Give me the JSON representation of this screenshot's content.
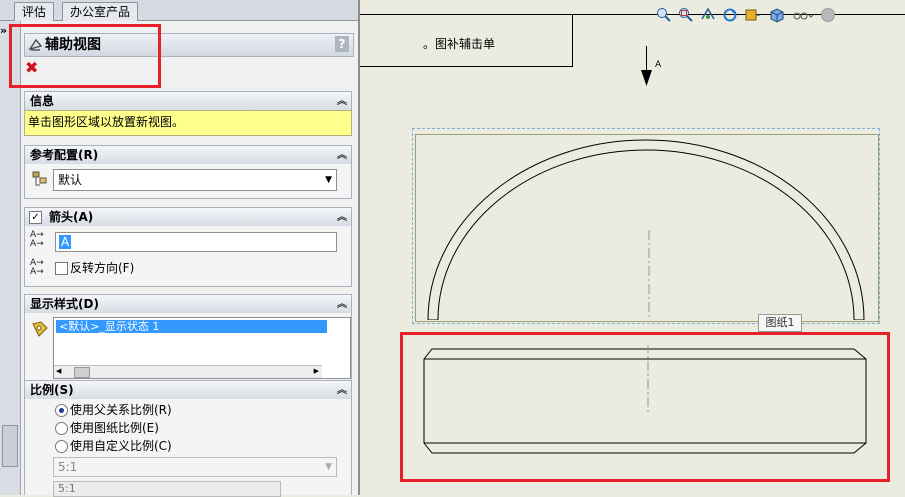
{
  "tabs": [
    "评估",
    "办公室产品"
  ],
  "tabs_overflow": "»",
  "property_manager": {
    "title": "辅助视图",
    "help": "?",
    "close_icon": "✖",
    "sections": {
      "info": {
        "title": "信息",
        "message": "单击图形区域以放置新视图。"
      },
      "reference_config": {
        "title": "参考配置(R)",
        "value": "默认"
      },
      "arrow": {
        "title": "箭头(A)",
        "label_value": "A",
        "reverse_label": "反转方向(F)",
        "arrow_icon_text": "A→"
      },
      "display_style": {
        "title": "显示样式(D)",
        "list_item": "<默认>_显示状态 1"
      },
      "scale": {
        "title": "比例(S)",
        "options": [
          "使用父关系比例(R)",
          "使用图纸比例(E)",
          "使用自定义比例(C)"
        ],
        "selected": 0,
        "dropdown_value": "5:1",
        "custom_value": "5:1"
      }
    }
  },
  "drawing": {
    "mirrored_note": "。图补辅击单",
    "view_arrow_label": "A",
    "sheet_tooltip": "图纸1"
  },
  "colors": {
    "accent_red": "#e8202a",
    "info_yellow": "#ffff8c"
  }
}
